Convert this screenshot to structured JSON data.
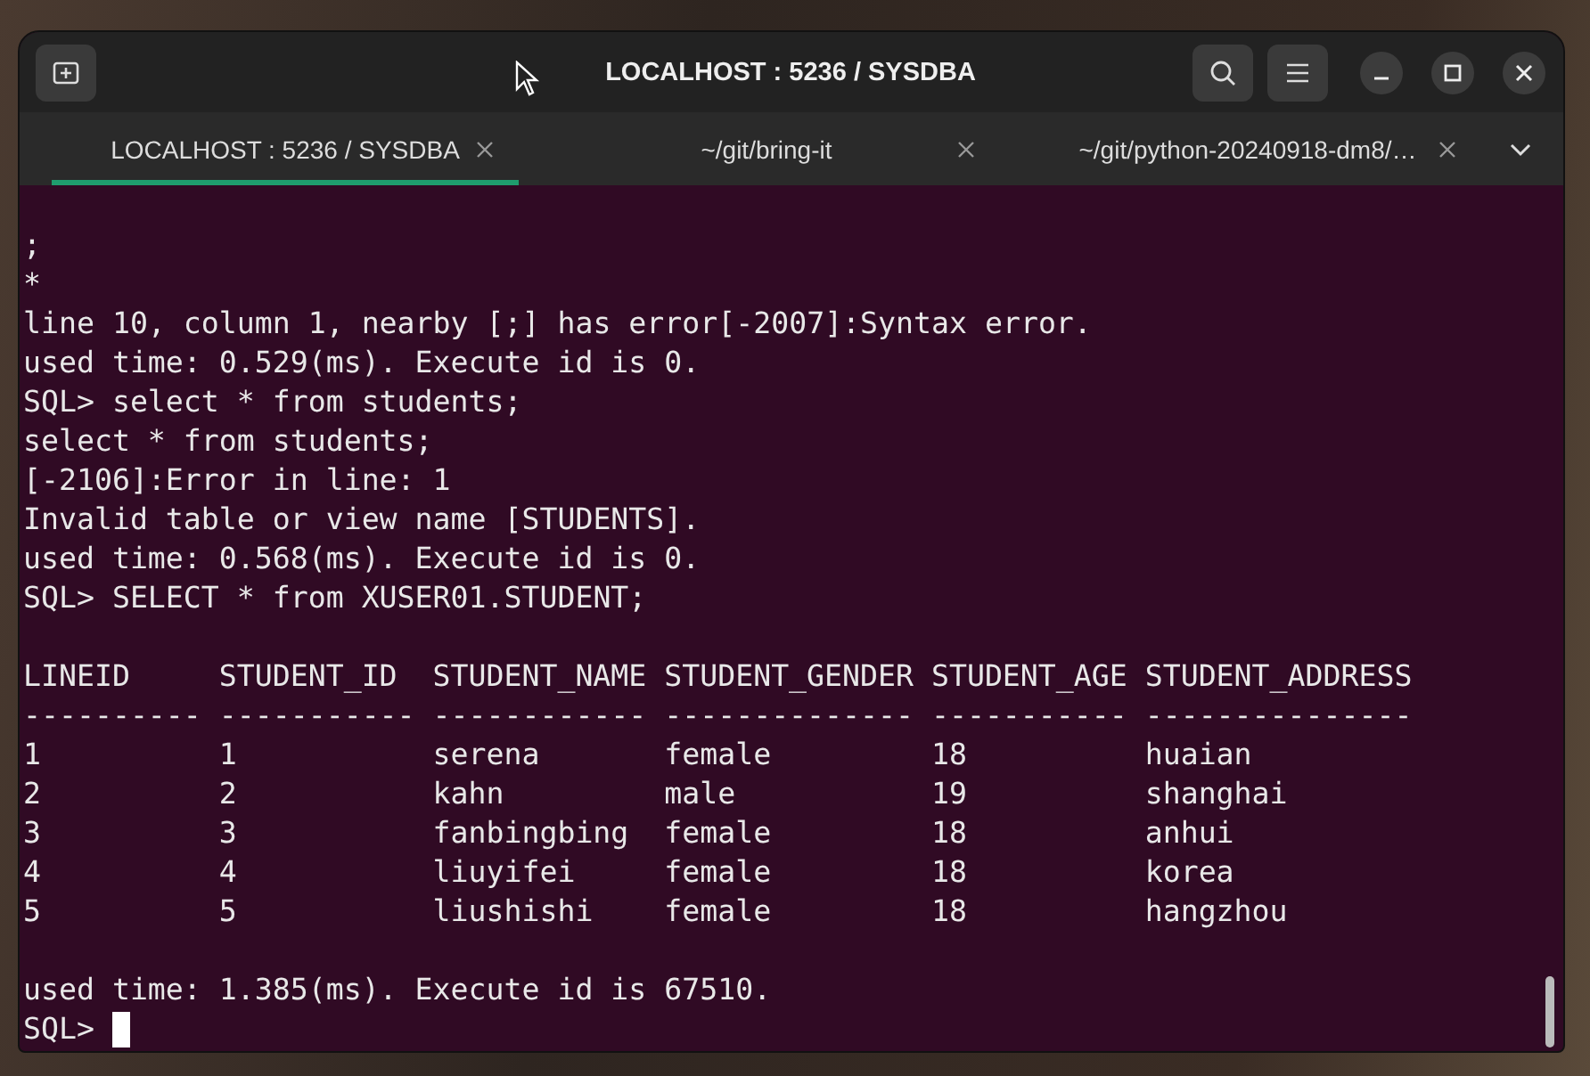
{
  "window": {
    "title": "LOCALHOST : 5236 / SYSDBA"
  },
  "tabs": [
    {
      "label": "LOCALHOST : 5236 / SYSDBA",
      "selected": true
    },
    {
      "label": "~/git/bring-it",
      "selected": false
    },
    {
      "label": "~/git/python-20240918-dm8/…",
      "selected": false
    }
  ],
  "terminal": {
    "lines": [
      {
        "kind": "text",
        "text": ";"
      },
      {
        "kind": "text",
        "text": "*"
      },
      {
        "kind": "text",
        "text": "line 10, column 1, nearby [;] has error[-2007]:Syntax error."
      },
      {
        "kind": "text",
        "text": "used time: 0.529(ms). Execute id is 0."
      },
      {
        "kind": "text",
        "text": "SQL> select * from students;"
      },
      {
        "kind": "text",
        "text": "select * from students;"
      },
      {
        "kind": "text",
        "text": "[-2106]:Error in line: 1"
      },
      {
        "kind": "text",
        "text": "Invalid table or view name [STUDENTS]."
      },
      {
        "kind": "text",
        "text": "used time: 0.568(ms). Execute id is 0."
      },
      {
        "kind": "text",
        "text": "SQL> SELECT * from XUSER01.STUDENT;"
      },
      {
        "kind": "blank"
      }
    ],
    "table": {
      "columns": [
        "LINEID",
        "STUDENT_ID",
        "STUDENT_NAME",
        "STUDENT_GENDER",
        "STUDENT_AGE",
        "STUDENT_ADDRESS"
      ],
      "separators": [
        "----------",
        "-----------",
        "------------",
        "--------------",
        "-----------",
        "---------------"
      ],
      "rows": [
        [
          "1",
          "1",
          "serena",
          "female",
          "18",
          "huaian"
        ],
        [
          "2",
          "2",
          "kahn",
          "male",
          "19",
          "shanghai"
        ],
        [
          "3",
          "3",
          "fanbingbing",
          "female",
          "18",
          "anhui"
        ],
        [
          "4",
          "4",
          "liuyifei",
          "female",
          "18",
          "korea"
        ],
        [
          "5",
          "5",
          "liushishi",
          "female",
          "18",
          "hangzhou"
        ]
      ]
    },
    "after": [
      {
        "kind": "blank"
      },
      {
        "kind": "text",
        "text": "used time: 1.385(ms). Execute id is 67510."
      }
    ],
    "prompt": "SQL>"
  }
}
